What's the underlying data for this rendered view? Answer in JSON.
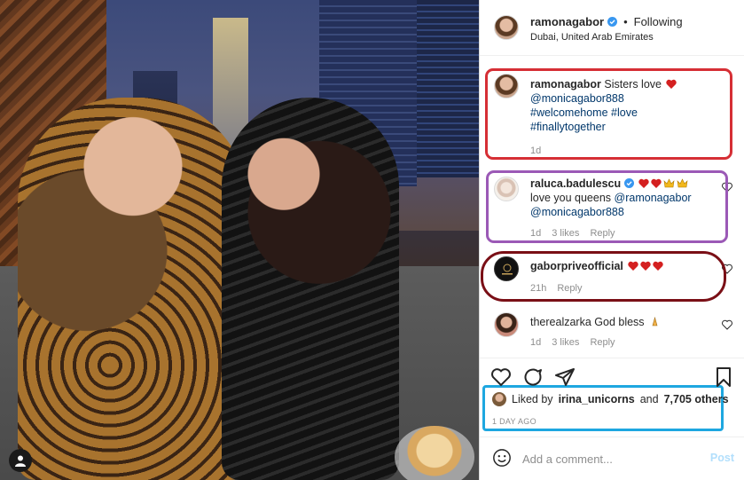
{
  "post": {
    "author": "ramonagabor",
    "following_label": "Following",
    "separator": "•",
    "location": "Dubai, United Arab Emirates"
  },
  "caption": {
    "username": "ramonagabor",
    "text": "Sisters love",
    "mention": "@monicagabor888",
    "hashtags": [
      "#welcomehome",
      "#love",
      "#finallytogether"
    ],
    "time": "1d"
  },
  "comments": [
    {
      "username": "raluca.badulescu",
      "text_prefix": "love you queens",
      "mention1": "@ramonagabor",
      "mention2": "@monicagabor888",
      "time": "1d",
      "likes": "3 likes",
      "reply": "Reply"
    },
    {
      "username": "gaborpriveofficial",
      "time": "21h",
      "reply": "Reply"
    },
    {
      "username": "therealzarka",
      "text": "God bless",
      "time": "1d",
      "likes": "3 likes",
      "reply": "Reply"
    }
  ],
  "likes": {
    "prefix": "Liked by",
    "user": "irina_unicorns",
    "middle": "and",
    "count": "7,705 others",
    "ago": "1 DAY AGO"
  },
  "composer": {
    "placeholder": "Add a comment...",
    "post_label": "Post"
  },
  "colors": {
    "heart": "#ed4956",
    "verified": "#3897f0",
    "mention": "#00376b",
    "box_red": "#d62f35",
    "box_purple": "#9b59b6",
    "box_maroon": "#7a0f16",
    "box_blue": "#1ea7e0"
  }
}
